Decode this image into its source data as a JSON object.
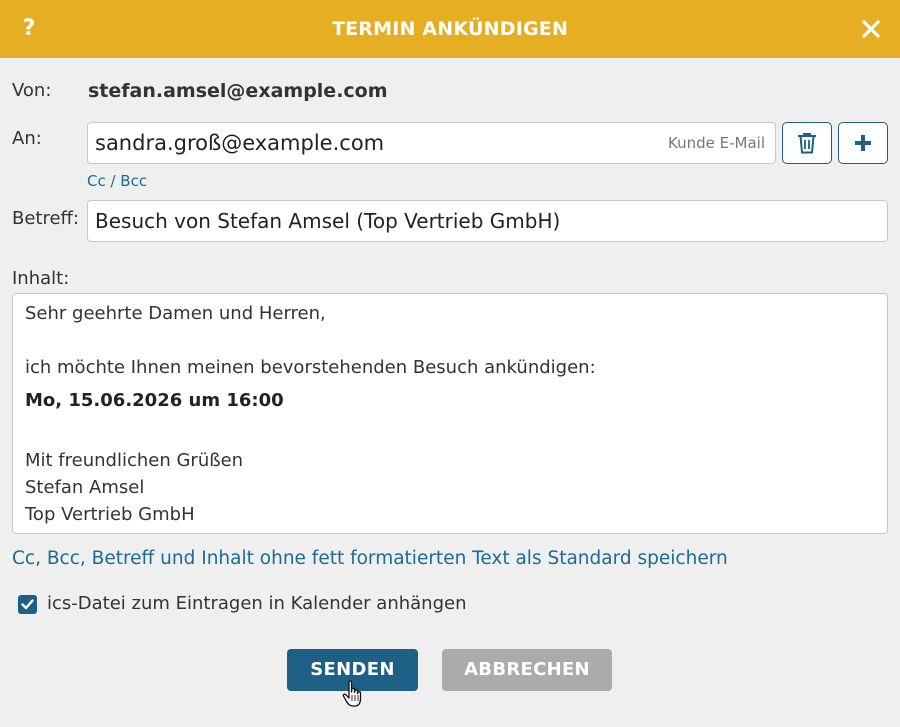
{
  "header": {
    "help_label": "?",
    "title": "TERMIN ANKÜNDIGEN"
  },
  "from": {
    "label": "Von:",
    "value": "stefan.amsel@example.com"
  },
  "to": {
    "label": "An:",
    "value": "sandra.groß@example.com",
    "hint": "Kunde E-Mail",
    "cc_bcc_link": "Cc / Bcc"
  },
  "subject": {
    "label": "Betreff:",
    "value": "Besuch von Stefan Amsel (Top Vertrieb GmbH)"
  },
  "content": {
    "label": "Inhalt:",
    "greeting": "Sehr geehrte Damen und Herren,",
    "intro": "ich möchte Ihnen meinen bevorstehenden Besuch ankündigen:",
    "date_line": "Mo, 15.06.2026 um 16:00",
    "closing": "Mit freundlichen Grüßen",
    "signature_name": "Stefan Amsel",
    "signature_company": "Top Vertrieb GmbH"
  },
  "save_default_link": "Cc, Bcc, Betreff und Inhalt ohne fett formatierten Text als Standard speichern",
  "attach_ics": {
    "label": "ics-Datei zum Eintragen in Kalender anhängen",
    "checked": true
  },
  "buttons": {
    "send": "SENDEN",
    "cancel": "ABBRECHEN"
  },
  "colors": {
    "header": "#e6ae23",
    "primary": "#1e5f85",
    "link": "#1d6a96",
    "cancel": "#ababab"
  }
}
